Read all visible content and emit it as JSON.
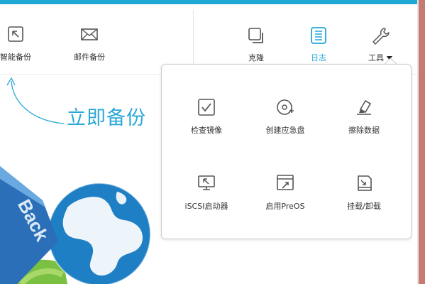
{
  "toolbar": {
    "smart_backup": "智能备份",
    "email_backup": "邮件备份",
    "clone": "克隆",
    "log": "日志",
    "tools": "工具"
  },
  "hero": {
    "backup_now": "立即备份",
    "logo_text": "Back"
  },
  "tools_menu": {
    "items": [
      {
        "label": "检查镜像",
        "icon": "check-image-icon"
      },
      {
        "label": "创建应急盘",
        "icon": "create-rescue-disk-icon"
      },
      {
        "label": "擦除数据",
        "icon": "eraser-icon"
      },
      {
        "label": "iSCSI启动器",
        "icon": "iscsi-initiator-icon"
      },
      {
        "label": "启用PreOS",
        "icon": "preos-icon"
      },
      {
        "label": "挂载/卸载",
        "icon": "mount-unmount-icon"
      }
    ]
  },
  "colors": {
    "accent": "#1fa7d6",
    "top_bar": "#1fa7d6",
    "text": "#333333"
  }
}
